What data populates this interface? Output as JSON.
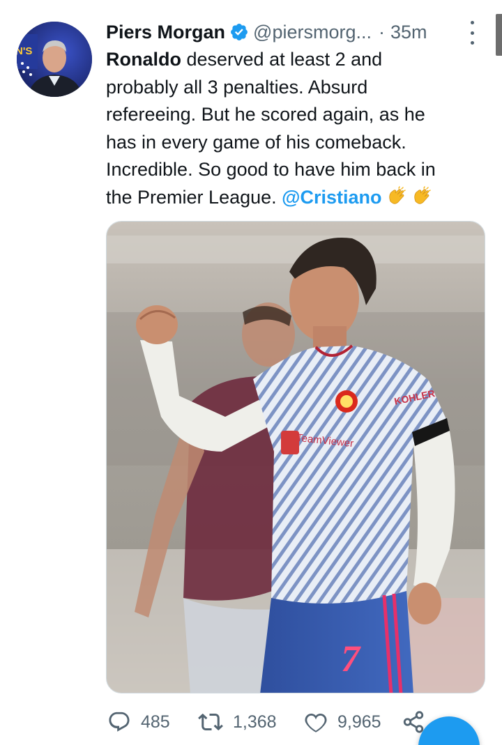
{
  "tweet": {
    "author_name": "Piers Morgan",
    "handle": "@piersmorg...",
    "separator": "·",
    "time": "35m",
    "verified": true,
    "avatar_badge_text": "N'S",
    "text_lines": [
      {
        "bold": "Ronaldo",
        "rest": " deserved at least 2 and"
      },
      "probably all 3 penalties. Absurd",
      "refereeing. But he scored again, as he",
      "has in every game of his comeback.",
      "Incredible. So good to have him back in",
      {
        "prefix": "the Premier League. ",
        "mention": "@Cristiano",
        "emoji": "clapping-hands x2"
      }
    ],
    "media": {
      "description": "photo",
      "shirt_number": "7",
      "sponsor_text": "KOHLER",
      "chest_text": "TeamViewer"
    },
    "stats": {
      "replies": "485",
      "retweets": "1,368",
      "likes": "9,965"
    }
  },
  "colors": {
    "accent": "#1d9bf0",
    "secondary_text": "#536471",
    "primary_text": "#0f1419"
  },
  "icons": {
    "verified": "verified-badge-icon",
    "more": "more-vertical-icon",
    "reply": "reply-bubble-icon",
    "retweet": "retweet-icon",
    "like": "heart-icon",
    "share": "share-icon",
    "compose": "compose-fab"
  }
}
